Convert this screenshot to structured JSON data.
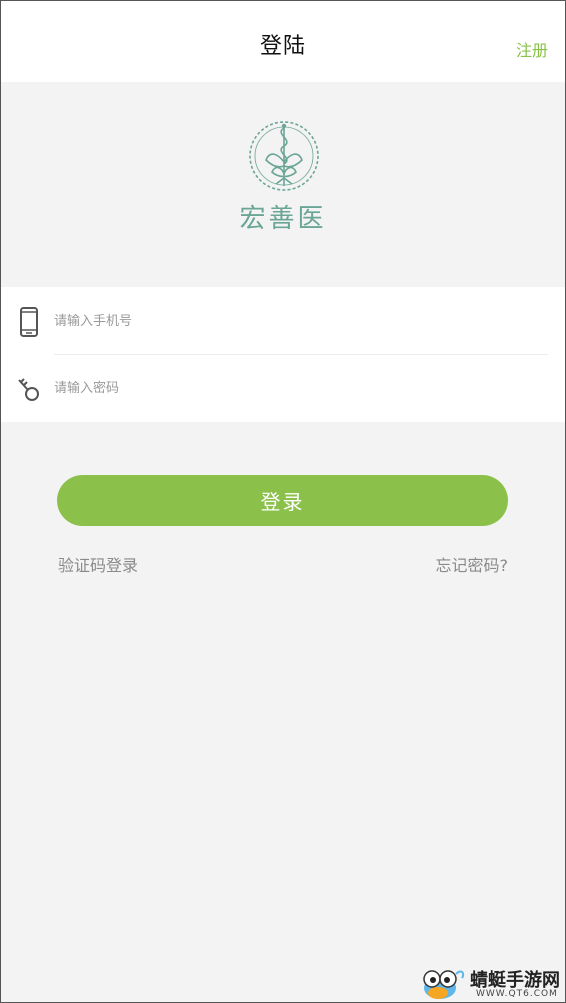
{
  "header": {
    "title": "登陆",
    "register_label": "注册"
  },
  "brand": {
    "name": "宏善医",
    "logo_icon": "caduceus-flower-wreath-icon",
    "logo_color": "#6aa595"
  },
  "form": {
    "phone": {
      "placeholder": "请输入手机号",
      "value": "",
      "icon": "phone-icon"
    },
    "password": {
      "placeholder": "请输入密码",
      "value": "",
      "icon": "key-icon"
    }
  },
  "actions": {
    "login_label": "登录",
    "sms_login_label": "验证码登录",
    "forgot_password_label": "忘记密码?"
  },
  "watermark": {
    "name": "蜻蜓手游网",
    "url": "WWW.QT6.COM"
  },
  "colors": {
    "accent": "#8bc14b",
    "background": "#f3f3f3",
    "link_gray": "#8a8a8a"
  }
}
